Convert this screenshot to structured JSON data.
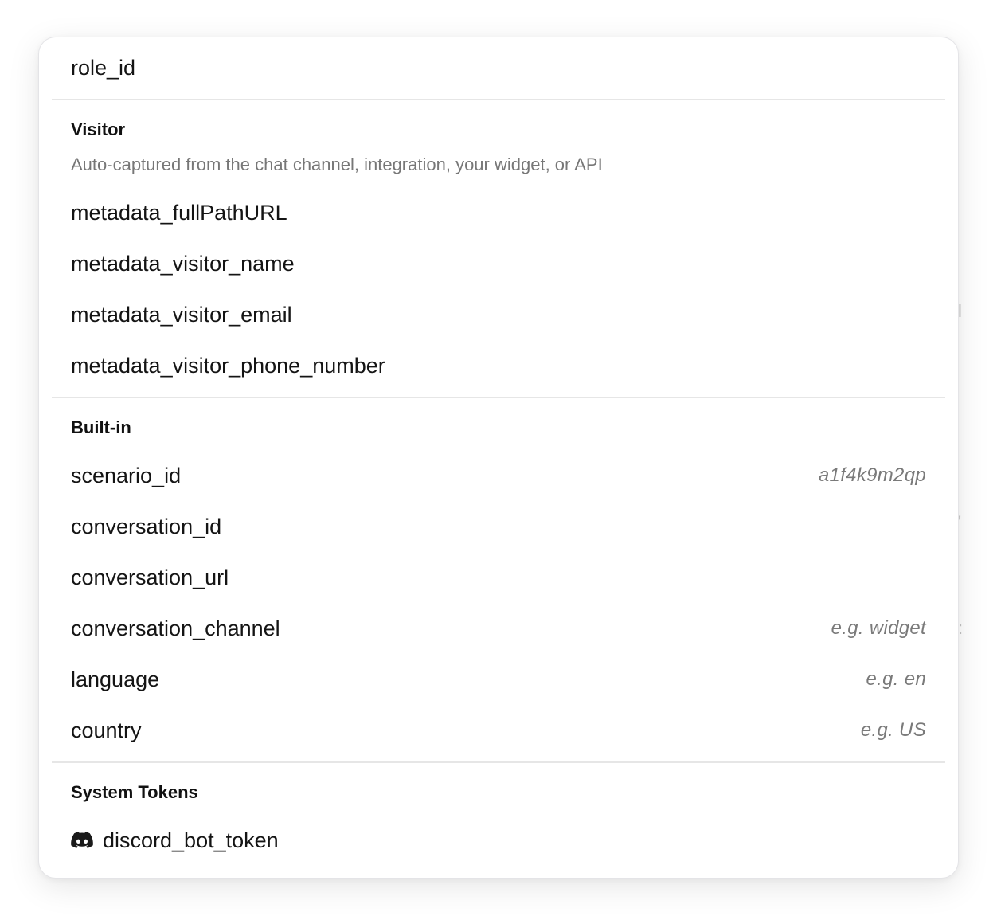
{
  "top_item": {
    "label": "role_id"
  },
  "visitor": {
    "heading": "Visitor",
    "description": "Auto-captured from the chat channel, integration, your widget, or API",
    "items": [
      {
        "label": "metadata_fullPathURL"
      },
      {
        "label": "metadata_visitor_name"
      },
      {
        "label": "metadata_visitor_email"
      },
      {
        "label": "metadata_visitor_phone_number"
      }
    ]
  },
  "builtin": {
    "heading": "Built-in",
    "items": [
      {
        "label": "scenario_id",
        "hint": "a1f4k9m2qp"
      },
      {
        "label": "conversation_id",
        "hint": ""
      },
      {
        "label": "conversation_url",
        "hint": ""
      },
      {
        "label": "conversation_channel",
        "hint": "e.g. widget"
      },
      {
        "label": "language",
        "hint": "e.g. en"
      },
      {
        "label": "country",
        "hint": "e.g. US"
      }
    ]
  },
  "system_tokens": {
    "heading": "System Tokens",
    "items": [
      {
        "label": "discord_bot_token",
        "icon": "discord-icon"
      }
    ]
  },
  "colors": {
    "text": "#141414",
    "muted": "#777777",
    "divider": "#e6e6e6",
    "discord_icon": "#1a1a1a"
  }
}
